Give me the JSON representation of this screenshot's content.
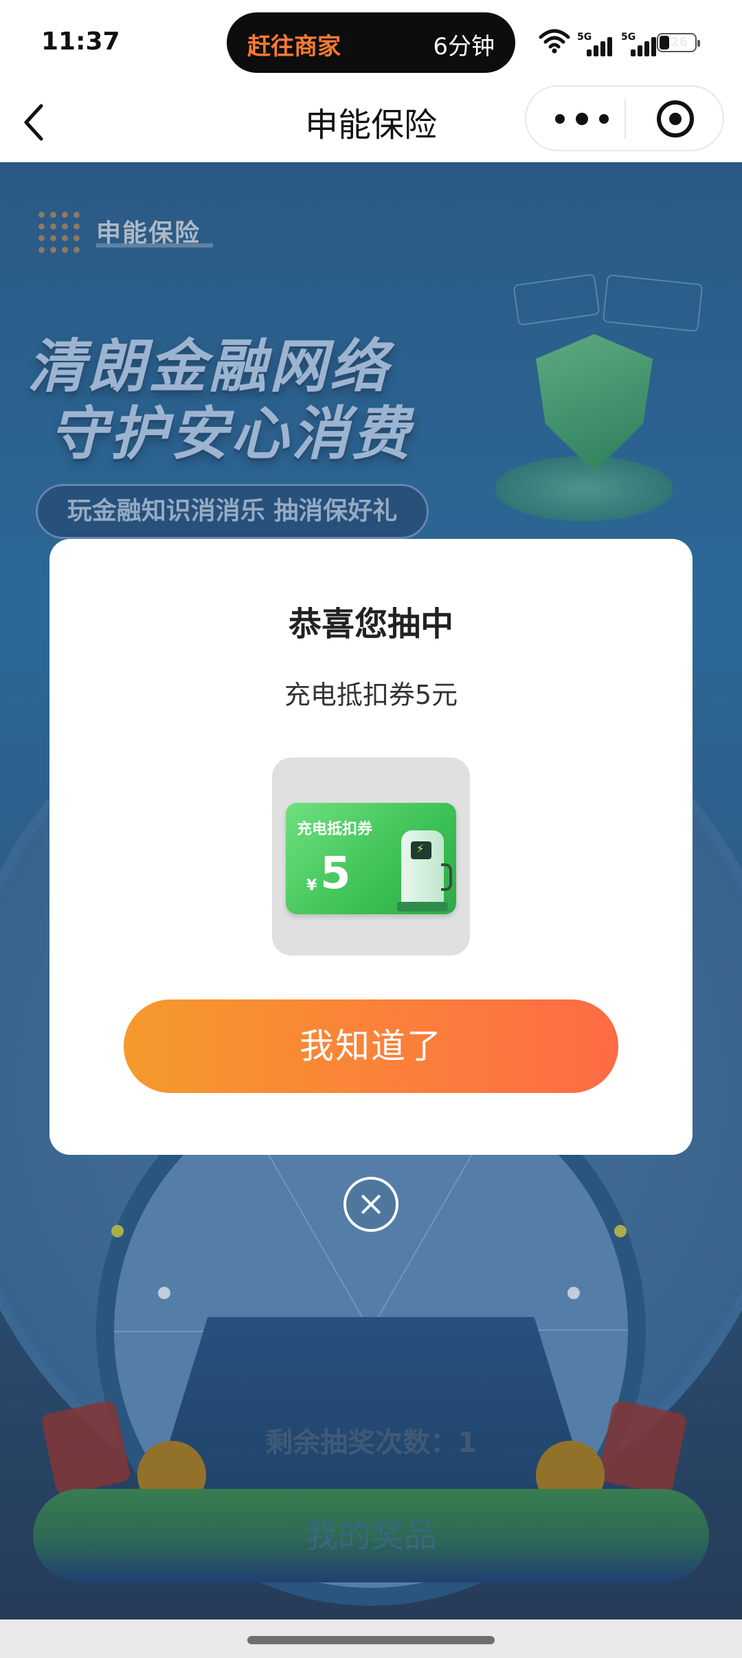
{
  "status_bar": {
    "time": "11:37",
    "live_activity_left": "赶往商家",
    "live_activity_right": "6分钟",
    "battery": "26",
    "network_labels": [
      "5G",
      "5G"
    ]
  },
  "nav": {
    "title": "申能保险"
  },
  "background": {
    "logo_text": "申能保险",
    "slogan_line1": "清朗金融网络",
    "slogan_line2": "守护安心消费",
    "subtitle": "玩金融知识消消乐 抽消保好礼",
    "remaining_draws": "剩余抽奖次数：1",
    "my_prizes_button": "我的奖品"
  },
  "modal": {
    "title": "恭喜您抽中",
    "prize_name": "充电抵扣券5元",
    "coupon_label": "充电抵扣券",
    "coupon_currency": "¥",
    "coupon_amount": "5",
    "confirm_button": "我知道了"
  },
  "colors": {
    "confirm_gradient_start": "#f59a2c",
    "confirm_gradient_end": "#ff6b45",
    "coupon_green": "#3cc155",
    "accent_orange": "#ff7a33"
  }
}
